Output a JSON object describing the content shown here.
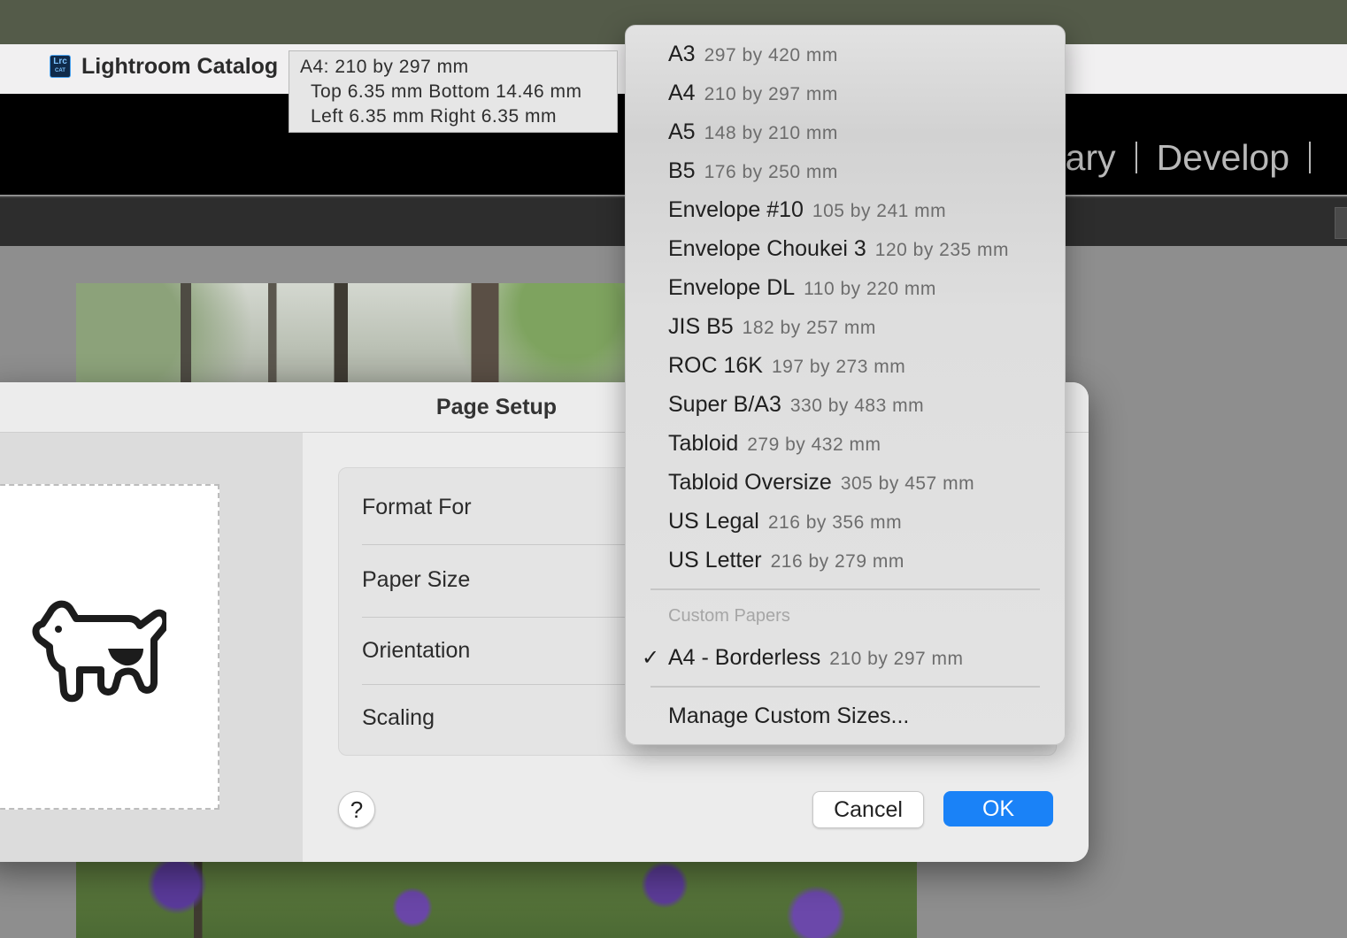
{
  "app": {
    "title": "Lightroom Catalog",
    "logo_text": "Lrc",
    "logo_sub": "CAT",
    "modules": [
      "rary",
      "Develop"
    ]
  },
  "tooltip": {
    "paper": "A4: 210 by 297 mm",
    "margins_tb": "Top 6.35 mm  Bottom 14.46 mm",
    "margins_lr": "Left 6.35 mm  Right 6.35 mm"
  },
  "dialog": {
    "title": "Page Setup",
    "rows": {
      "format_for": "Format For",
      "paper_size": "Paper Size",
      "orientation": "Orientation",
      "scaling": "Scaling"
    },
    "help": "?",
    "cancel": "Cancel",
    "ok": "OK"
  },
  "menu": {
    "items": [
      {
        "name": "A3",
        "size": "297 by 420 mm"
      },
      {
        "name": "A4",
        "size": "210 by 297 mm"
      },
      {
        "name": "A5",
        "size": "148 by 210 mm"
      },
      {
        "name": "B5",
        "size": "176 by 250 mm"
      },
      {
        "name": "Envelope #10",
        "size": "105 by 241 mm"
      },
      {
        "name": "Envelope Choukei 3",
        "size": "120 by 235 mm"
      },
      {
        "name": "Envelope DL",
        "size": "110 by 220 mm"
      },
      {
        "name": "JIS B5",
        "size": "182 by 257 mm"
      },
      {
        "name": "ROC 16K",
        "size": "197 by 273 mm"
      },
      {
        "name": "Super B/A3",
        "size": "330 by 483 mm"
      },
      {
        "name": "Tabloid",
        "size": "279 by 432 mm"
      },
      {
        "name": "Tabloid Oversize",
        "size": "305 by 457 mm"
      },
      {
        "name": "US Legal",
        "size": "216 by 356 mm"
      },
      {
        "name": "US Letter",
        "size": "216 by 279 mm"
      }
    ],
    "custom_header": "Custom Papers",
    "custom_item": {
      "name": "A4 - Borderless",
      "size": "210 by 297 mm",
      "checked": true
    },
    "checkmark": "✓",
    "manage": "Manage Custom Sizes..."
  },
  "colors": {
    "accent": "#1a82f7",
    "desktop": "#545b49"
  }
}
